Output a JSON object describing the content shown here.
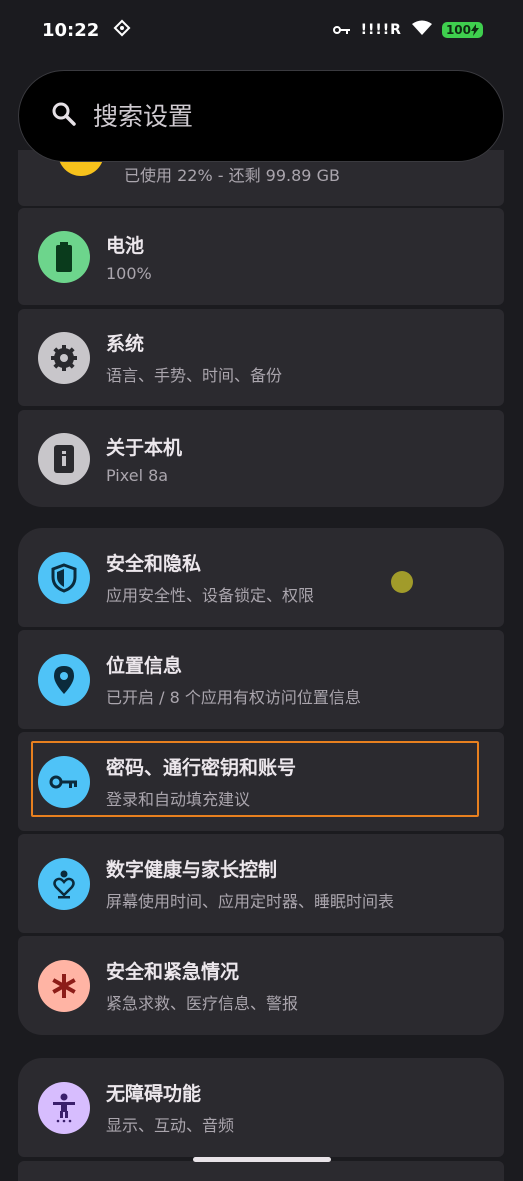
{
  "status": {
    "time": "10:22",
    "signal": "!!!!R",
    "battery": "100"
  },
  "search": {
    "placeholder": "搜索设置"
  },
  "partial_item": {
    "subtitle": "已使用 22% - 还剩 99.89 GB"
  },
  "groups": [
    {
      "items": [
        {
          "title": "电池",
          "subtitle": "100%",
          "icon": "battery-icon",
          "color": "#6dd58c"
        },
        {
          "title": "系统",
          "subtitle": "语言、手势、时间、备份",
          "icon": "gear-icon",
          "color": "#c8c6ca"
        },
        {
          "title": "关于本机",
          "subtitle": "Pixel 8a",
          "icon": "phone-info-icon",
          "color": "#c8c6ca"
        }
      ]
    },
    {
      "items": [
        {
          "title": "安全和隐私",
          "subtitle": "应用安全性、设备锁定、权限",
          "icon": "shield-icon",
          "color": "#4fc3f7"
        },
        {
          "title": "位置信息",
          "subtitle": "已开启 / 8 个应用有权访问位置信息",
          "icon": "location-pin-icon",
          "color": "#4fc3f7"
        },
        {
          "title": "密码、通行密钥和账号",
          "subtitle": "登录和自动填充建议",
          "icon": "key-icon",
          "color": "#4fc3f7"
        },
        {
          "title": "数字健康与家长控制",
          "subtitle": "屏幕使用时间、应用定时器、睡眠时间表",
          "icon": "heart-person-icon",
          "color": "#4fc3f7"
        },
        {
          "title": "安全和紧急情况",
          "subtitle": "紧急求救、医疗信息、警报",
          "icon": "asterisk-icon",
          "color": "#ffb4a4"
        }
      ]
    },
    {
      "items": [
        {
          "title": "无障碍功能",
          "subtitle": "显示、互动、音频",
          "icon": "accessibility-icon",
          "color": "#d7bdfe"
        }
      ]
    }
  ]
}
